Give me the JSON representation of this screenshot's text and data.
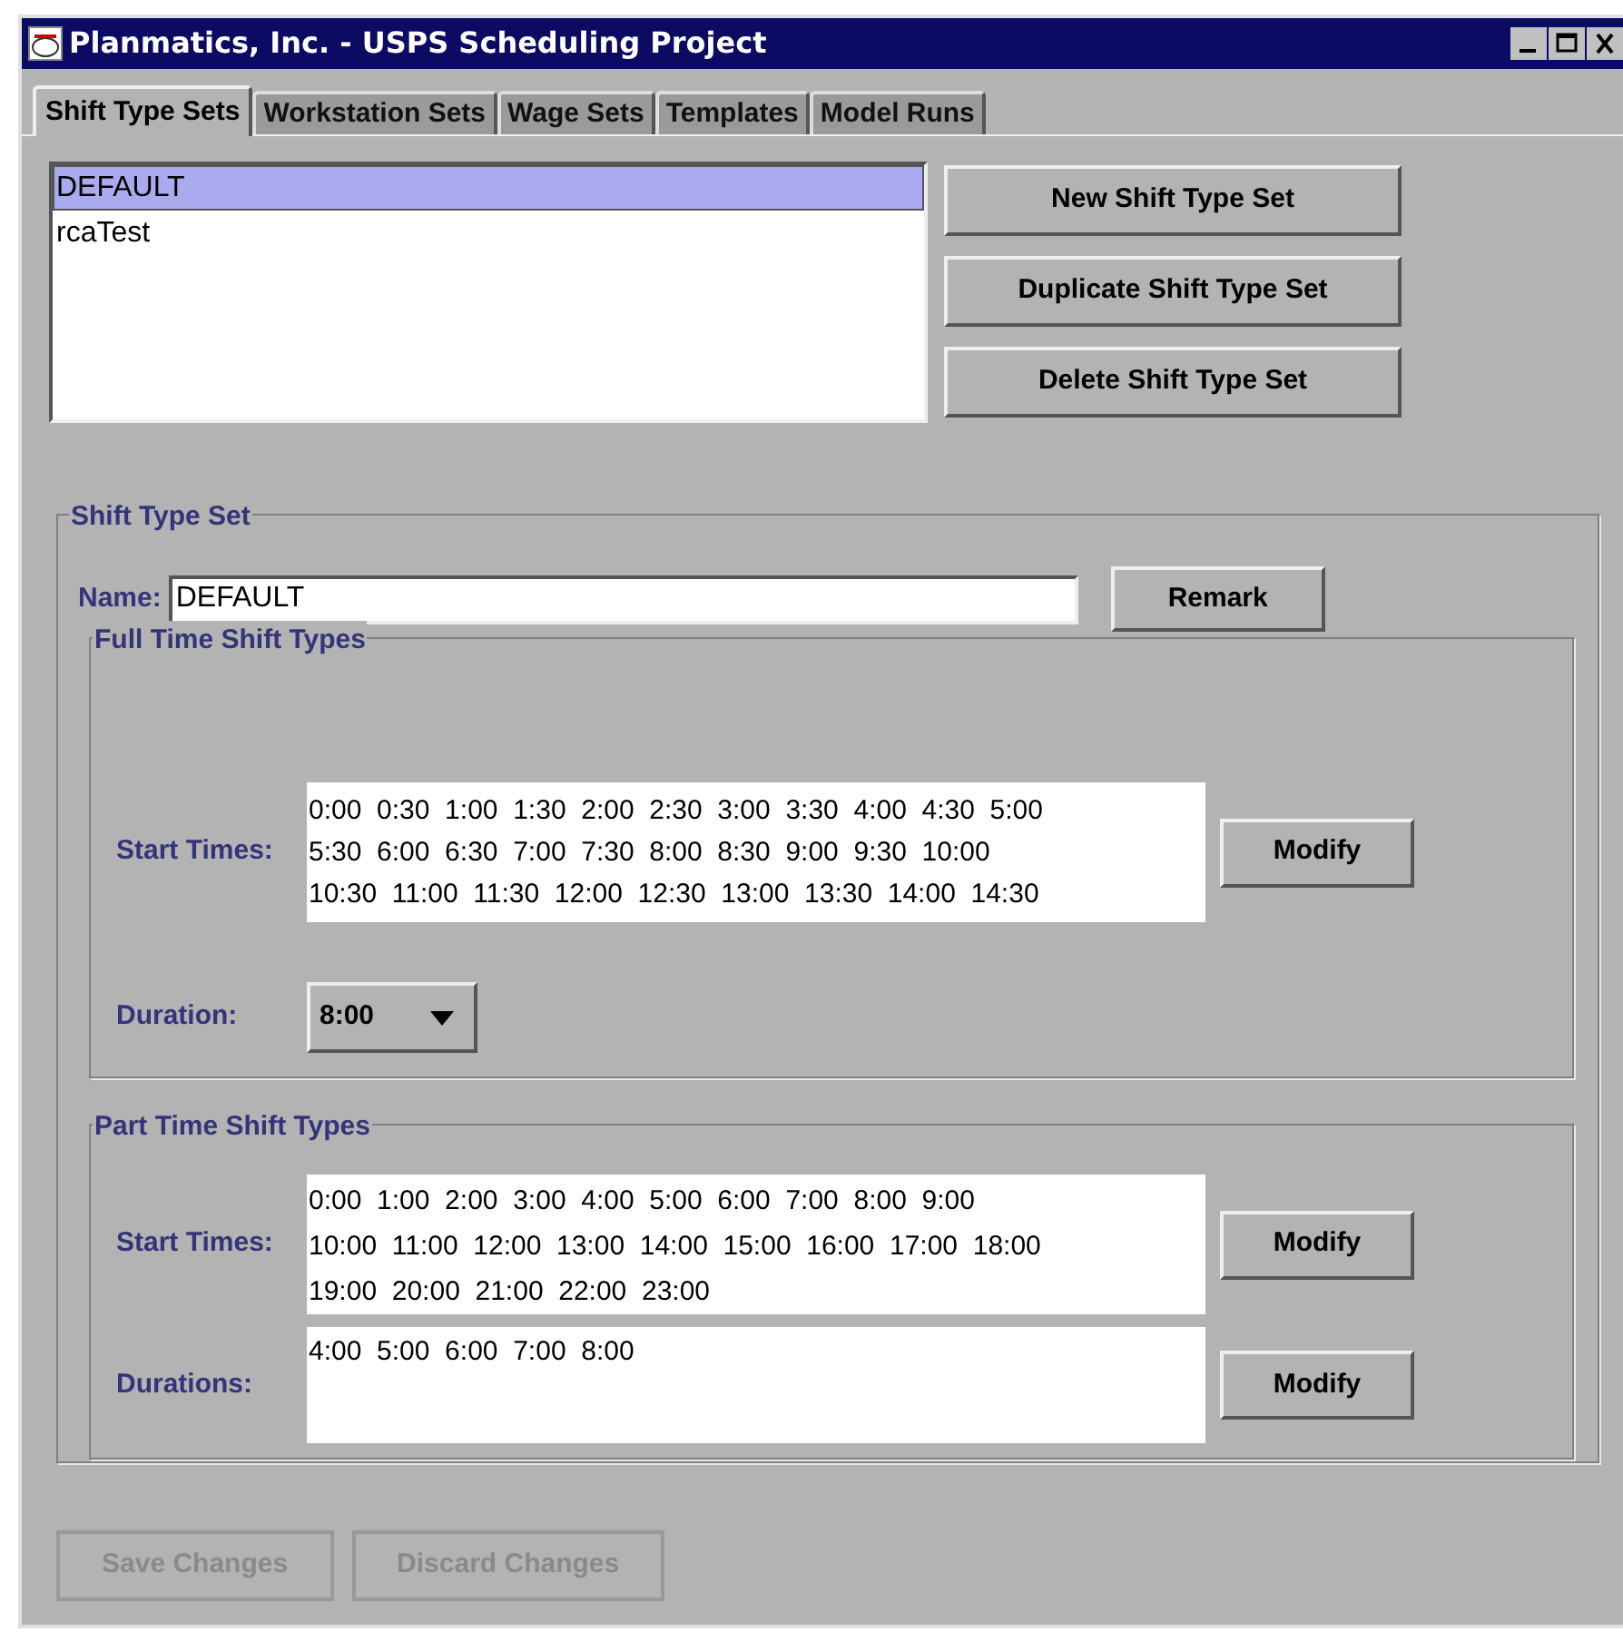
{
  "window": {
    "title": "Planmatics, Inc. - USPS Scheduling Project"
  },
  "tabs": [
    {
      "label": "Shift Type Sets",
      "selected": true
    },
    {
      "label": "Workstation Sets",
      "selected": false
    },
    {
      "label": "Wage Sets",
      "selected": false
    },
    {
      "label": "Templates",
      "selected": false
    },
    {
      "label": "Model Runs",
      "selected": false
    }
  ],
  "set_list": [
    {
      "label": "DEFAULT",
      "selected": true
    },
    {
      "label": "rcaTest",
      "selected": false
    }
  ],
  "set_buttons": [
    "New Shift Type Set",
    "Duplicate Shift Type Set",
    "Delete Shift Type Set"
  ],
  "shift_type_set": {
    "title": "Shift Type Set",
    "name_label": "Name:",
    "name_value": "DEFAULT",
    "remark_button": "Remark",
    "full_time": {
      "title": "Full Time Shift Types",
      "start_times_label": "Start Times:",
      "start_times": [
        "0:00  0:30  1:00  1:30  2:00  2:30  3:00  3:30  4:00  4:30  5:00",
        "5:30  6:00  6:30  7:00  7:30  8:00  8:30  9:00  9:30  10:00",
        "10:30  11:00  11:30  12:00  12:30  13:00  13:30  14:00  14:30"
      ],
      "modify_button": "Modify",
      "duration_label": "Duration:",
      "duration_value": "8:00"
    },
    "part_time": {
      "title": "Part Time Shift Types",
      "start_times_label": "Start Times:",
      "start_times": [
        "0:00  1:00  2:00  3:00  4:00  5:00  6:00  7:00  8:00  9:00",
        "10:00  11:00  12:00  13:00  14:00  15:00  16:00  17:00  18:00",
        "19:00  20:00  21:00  22:00  23:00"
      ],
      "start_modify_button": "Modify",
      "durations_label": "Durations:",
      "durations": [
        "4:00  5:00  6:00  7:00  8:00"
      ],
      "durations_modify_button": "Modify"
    }
  },
  "footer_buttons": [
    {
      "label": "Save Changes",
      "disabled": true
    },
    {
      "label": "Discard Changes",
      "disabled": true
    }
  ]
}
